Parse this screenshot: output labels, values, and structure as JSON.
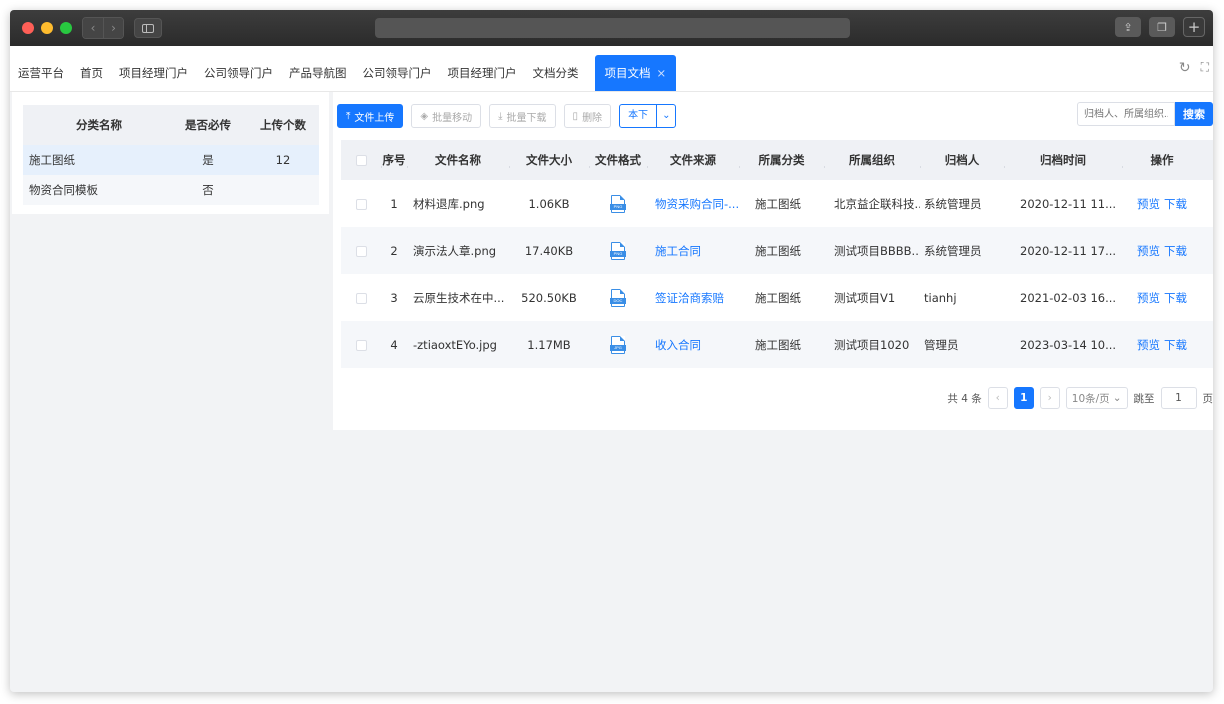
{
  "tabs": [
    {
      "label": "运营平台"
    },
    {
      "label": "首页"
    },
    {
      "label": "项目经理门户"
    },
    {
      "label": "公司领导门户"
    },
    {
      "label": "产品导航图"
    },
    {
      "label": "公司领导门户"
    },
    {
      "label": "项目经理门户"
    },
    {
      "label": "文档分类"
    }
  ],
  "active_tab": {
    "label": "项目文档",
    "close": "×"
  },
  "category_table": {
    "headers": {
      "name": "分类名称",
      "required": "是否必传",
      "count": "上传个数"
    },
    "rows": [
      {
        "name": "施工图纸",
        "required": "是",
        "count": "12"
      },
      {
        "name": "物资合同模板",
        "required": "否",
        "count": ""
      }
    ]
  },
  "toolbar": {
    "upload": "文件上传",
    "batch_move": "批量移动",
    "batch_download": "批量下载",
    "delete": "删除",
    "dropdown": "本下",
    "search_placeholder": "归档人、所属组织...",
    "search": "搜索"
  },
  "file_table": {
    "headers": {
      "no": "序号",
      "name": "文件名称",
      "size": "文件大小",
      "format": "文件格式",
      "source": "文件来源",
      "category": "所属分类",
      "org": "所属组织",
      "archiver": "归档人",
      "time": "归档时间",
      "ops": "操作"
    },
    "rows": [
      {
        "no": "1",
        "name": "材料退库.png",
        "size": "1.06KB",
        "format": "PNG",
        "source": "物资采购合同-...",
        "category": "施工图纸",
        "org": "北京益企联科技...",
        "archiver": "系统管理员",
        "time": "2020-12-11 11...",
        "preview": "预览",
        "download": "下载"
      },
      {
        "no": "2",
        "name": "演示法人章.png",
        "size": "17.40KB",
        "format": "PNG",
        "source": "施工合同",
        "category": "施工图纸",
        "org": "测试项目BBBB...",
        "archiver": "系统管理员",
        "time": "2020-12-11 17...",
        "preview": "预览",
        "download": "下载"
      },
      {
        "no": "3",
        "name": "云原生技术在中...",
        "size": "520.50KB",
        "format": "DOC",
        "source": "签证洽商索赔",
        "category": "施工图纸",
        "org": "测试项目V1",
        "archiver": "tianhj",
        "time": "2021-02-03 16...",
        "preview": "预览",
        "download": "下载"
      },
      {
        "no": "4",
        "name": "-ztiaoxtEYo.jpg",
        "size": "1.17MB",
        "format": "JPG",
        "source": "收入合同",
        "category": "施工图纸",
        "org": "测试项目1020",
        "archiver": "管理员",
        "time": "2023-03-14 10...",
        "preview": "预览",
        "download": "下载"
      }
    ]
  },
  "pagination": {
    "total": "共 4 条",
    "current_page": "1",
    "page_size": "10条/页",
    "jump_label": "跳至",
    "jump_value": "1",
    "page_suffix": "页"
  },
  "colors": {
    "accent": "#1677ff",
    "selected_row": "#e6f0fc"
  }
}
